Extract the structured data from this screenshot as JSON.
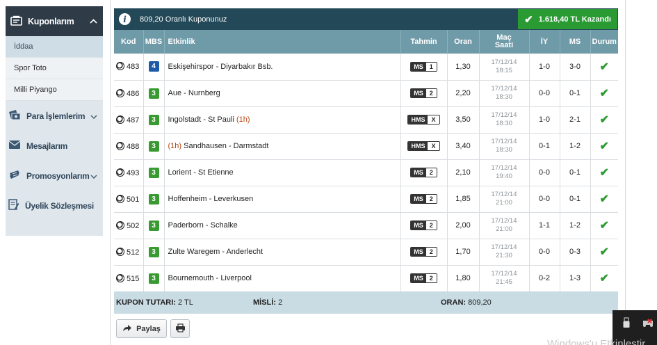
{
  "sidebar": {
    "header": "Kuponlarım",
    "sub_items": [
      {
        "label": "İddaa",
        "active": true
      },
      {
        "label": "Spor Toto",
        "active": false
      },
      {
        "label": "Milli Piyango",
        "active": false
      }
    ],
    "menu": [
      {
        "label": "Para İşlemlerim",
        "icon": "money-icon",
        "chevron": true
      },
      {
        "label": "Mesajlarım",
        "icon": "mail-icon",
        "chevron": false
      },
      {
        "label": "Promosyonlarım",
        "icon": "ticket-icon",
        "chevron": true
      },
      {
        "label": "Üyelik Sözleşmesi",
        "icon": "document-icon",
        "chevron": false
      }
    ]
  },
  "coupon": {
    "title": "809,20 Oranlı Kuponunuz",
    "won_label": "1.618,40 TL Kazandı",
    "columns": [
      "Kod",
      "MBS",
      "Etkinlik",
      "Tahmin",
      "Oran",
      "Maç Saati",
      "İY",
      "MS",
      "Durum"
    ],
    "rows": [
      {
        "kod": "483",
        "mbs": "4",
        "mbs_color": "#1d5ba8",
        "event_pre": "",
        "event": "Eskişehirspor - Diyarbakır Bsb.",
        "event_post": "",
        "tahmin_type": "MS",
        "tahmin_val": "1",
        "oran": "1,30",
        "date": "17/12/14",
        "time": "18:15",
        "iy": "1-0",
        "ms": "3-0"
      },
      {
        "kod": "486",
        "mbs": "3",
        "mbs_color": "#3a9a32",
        "event_pre": "",
        "event": "Aue - Nurnberg",
        "event_post": "",
        "tahmin_type": "MS",
        "tahmin_val": "2",
        "oran": "2,20",
        "date": "17/12/14",
        "time": "18:30",
        "iy": "0-0",
        "ms": "0-1"
      },
      {
        "kod": "487",
        "mbs": "3",
        "mbs_color": "#3a9a32",
        "event_pre": "",
        "event": "Ingolstadt - St Pauli",
        "event_post": "(1h)",
        "tahmin_type": "HMS",
        "tahmin_val": "X",
        "oran": "3,50",
        "date": "17/12/14",
        "time": "18:30",
        "iy": "1-0",
        "ms": "2-1"
      },
      {
        "kod": "488",
        "mbs": "3",
        "mbs_color": "#3a9a32",
        "event_pre": "(1h)",
        "event": "Sandhausen - Darmstadt",
        "event_post": "",
        "tahmin_type": "HMS",
        "tahmin_val": "X",
        "oran": "3,40",
        "date": "17/12/14",
        "time": "18:30",
        "iy": "0-1",
        "ms": "1-2"
      },
      {
        "kod": "493",
        "mbs": "3",
        "mbs_color": "#3a9a32",
        "event_pre": "",
        "event": "Lorient - St Etienne",
        "event_post": "",
        "tahmin_type": "MS",
        "tahmin_val": "2",
        "oran": "2,10",
        "date": "17/12/14",
        "time": "19:40",
        "iy": "0-0",
        "ms": "0-1"
      },
      {
        "kod": "501",
        "mbs": "3",
        "mbs_color": "#3a9a32",
        "event_pre": "",
        "event": "Hoffenheim - Leverkusen",
        "event_post": "",
        "tahmin_type": "MS",
        "tahmin_val": "2",
        "oran": "1,85",
        "date": "17/12/14",
        "time": "21:00",
        "iy": "0-0",
        "ms": "0-1"
      },
      {
        "kod": "502",
        "mbs": "3",
        "mbs_color": "#3a9a32",
        "event_pre": "",
        "event": "Paderborn - Schalke",
        "event_post": "",
        "tahmin_type": "MS",
        "tahmin_val": "2",
        "oran": "2,00",
        "date": "17/12/14",
        "time": "21:00",
        "iy": "1-1",
        "ms": "1-2"
      },
      {
        "kod": "512",
        "mbs": "3",
        "mbs_color": "#3a9a32",
        "event_pre": "",
        "event": "Zulte Waregem - Anderlecht",
        "event_post": "",
        "tahmin_type": "MS",
        "tahmin_val": "2",
        "oran": "1,70",
        "date": "17/12/14",
        "time": "21:30",
        "iy": "0-0",
        "ms": "0-3"
      },
      {
        "kod": "515",
        "mbs": "3",
        "mbs_color": "#3a9a32",
        "event_pre": "",
        "event": "Bournemouth - Liverpool",
        "event_post": "",
        "tahmin_type": "MS",
        "tahmin_val": "2",
        "oran": "1,80",
        "date": "17/12/14",
        "time": "21:45",
        "iy": "0-2",
        "ms": "1-3"
      }
    ],
    "summary": {
      "tutar_label": "KUPON TUTARI:",
      "tutar_value": "2 TL",
      "misli_label": "MİSLİ:",
      "misli_value": "2",
      "oran_label": "ORAN:",
      "oran_value": "809,20"
    },
    "share_label": "Paylaş"
  },
  "os": {
    "watermark": "Windows'u Etkinleştir"
  },
  "colors": {
    "header_bg": "#234858",
    "table_header_bg": "#6f9aa8",
    "won_bg": "#2a9a33",
    "sidebar_dark": "#2f3c48",
    "sidebar_light": "#dfe7ed",
    "summary_bg": "#c9dbe3"
  }
}
